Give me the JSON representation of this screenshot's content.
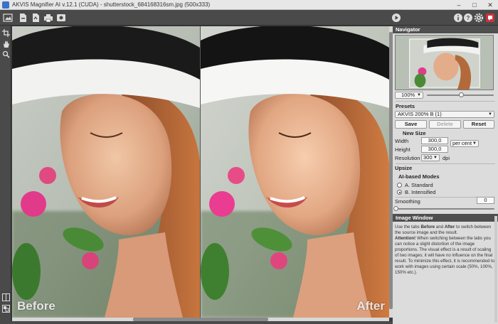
{
  "window": {
    "title": "AKVIS Magnifier AI v.12.1 (CUDA) - shutterstock_684168316sm.jpg (500x333)",
    "minimize": "–",
    "maximize": "□",
    "close": "✕"
  },
  "toolbar": {
    "icons": [
      "open-icon",
      "save-icon",
      "export-icon",
      "print-icon",
      "share-icon",
      "run-icon",
      "info-icon",
      "help-icon",
      "settings-icon",
      "notifications-icon"
    ]
  },
  "left_tools": [
    "crop-icon",
    "hand-icon",
    "zoom-icon",
    "split-view-icon",
    "compare-view-icon"
  ],
  "canvas": {
    "before_label": "Before",
    "after_label": "After"
  },
  "navigator": {
    "title": "Navigator",
    "zoom": "100%"
  },
  "presets": {
    "title": "Presets",
    "selected": "AKVIS 200% B (1)",
    "save_label": "Save",
    "delete_label": "Delete",
    "reset_label": "Reset"
  },
  "new_size": {
    "title": "New Size",
    "width_label": "Width",
    "width_value": "300,0",
    "height_label": "Height",
    "height_value": "300,0",
    "unit": "per cent",
    "resolution_label": "Resolution",
    "resolution_value": "300",
    "resolution_unit": "dpi"
  },
  "upsize": {
    "title": "Upsize",
    "modes_title": "AI-based Modes",
    "option_a": "A. Standard",
    "option_b": "B. Intensified",
    "selected": "B. Intensified"
  },
  "smoothing": {
    "label": "Smoothing",
    "value": "0"
  },
  "image_window": {
    "title": "Image Window",
    "text_1": "Use the tabs ",
    "before": "Before",
    "text_2": " and ",
    "after": "After",
    "text_3": " to switch between the source image and the result.",
    "attention": "Attention!",
    "text_4": " When switching between the tabs you can notice a slight distortion of the image proportions. The visual effect is a result of scaling of two images; it will have no influence on the final result. To minimize this effect, it is recommended to work with images using certain scale (50%, 100%, 150% etc.)."
  },
  "colors": {
    "panel_bg": "#dcdcdc",
    "toolbar_bg": "#4a4a4a",
    "section_header": "#4f4f4f"
  }
}
